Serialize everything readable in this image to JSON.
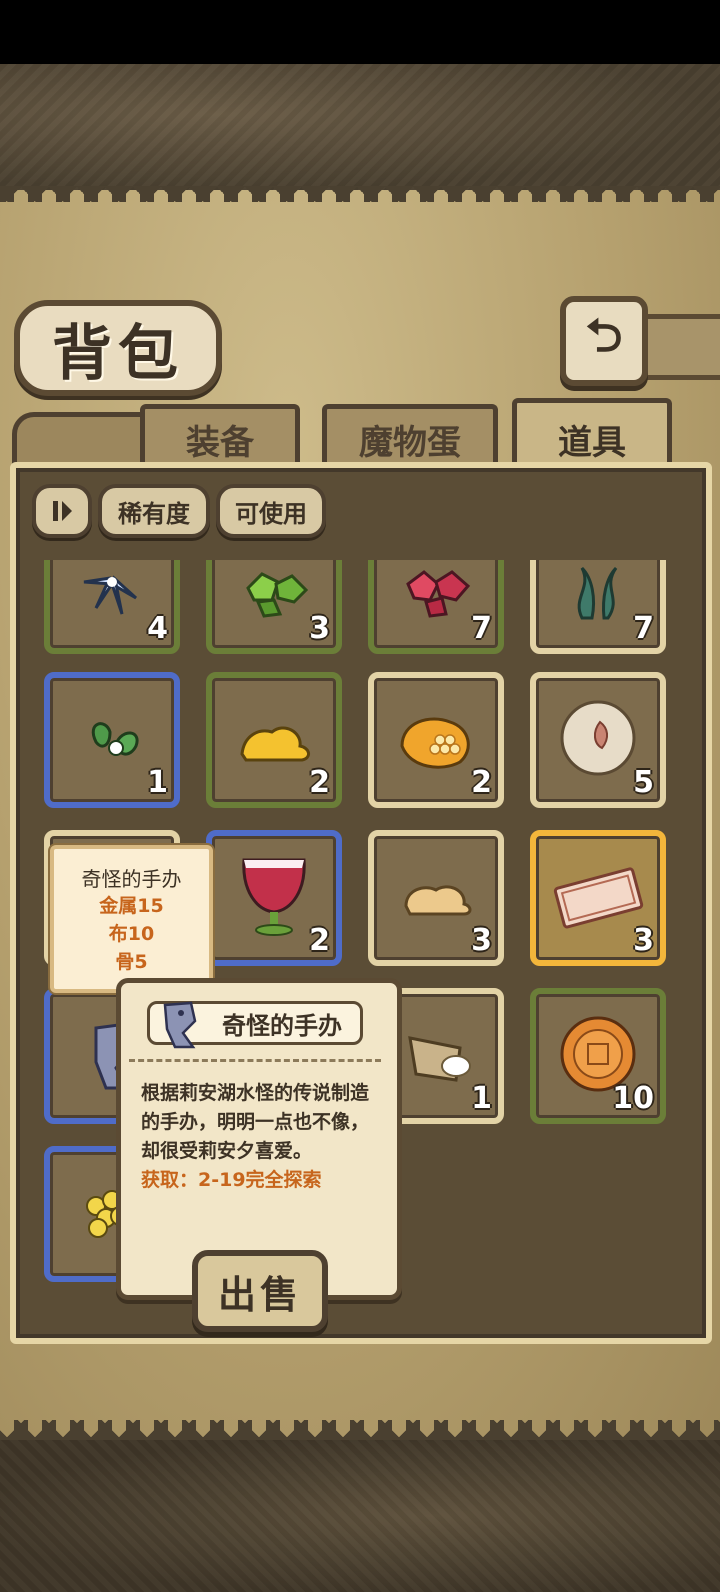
{
  "header": {
    "title": "背包"
  },
  "tabs": [
    {
      "label": "装备",
      "active": false
    },
    {
      "label": "魔物蛋",
      "active": false
    },
    {
      "label": "道具",
      "active": true
    }
  ],
  "filters": {
    "sort_icon": "sort-icon",
    "rarity_label": "稀有度",
    "usable_label": "可使用"
  },
  "items": [
    {
      "name": "blue-flower-icon",
      "qty": "4",
      "frame": "green"
    },
    {
      "name": "green-crystal-icon",
      "qty": "3",
      "frame": "green"
    },
    {
      "name": "red-crystal-icon",
      "qty": "7",
      "frame": "green"
    },
    {
      "name": "seaweed-icon",
      "qty": "7",
      "frame": "cream"
    },
    {
      "name": "tea-leaf-icon",
      "qty": "1",
      "frame": "blue"
    },
    {
      "name": "gold-blob-icon",
      "qty": "2",
      "frame": "green"
    },
    {
      "name": "honeycomb-icon",
      "qty": "2",
      "frame": "cream"
    },
    {
      "name": "pearl-icon",
      "qty": "5",
      "frame": "cream"
    },
    {
      "name": "figure-icon",
      "qty": "",
      "frame": "cream"
    },
    {
      "name": "wine-glass-icon",
      "qty": "2",
      "frame": "blue"
    },
    {
      "name": "dough-icon",
      "qty": "3",
      "frame": "cream"
    },
    {
      "name": "ticket-icon",
      "qty": "3",
      "frame": "gold"
    },
    {
      "name": "lake-monster-figure-icon",
      "qty": "",
      "frame": "blue"
    },
    {
      "name": "sack-icon",
      "qty": "",
      "frame": "blue"
    },
    {
      "name": "rice-bag-icon",
      "qty": "1",
      "frame": "cream"
    },
    {
      "name": "mooncake-icon",
      "qty": "10",
      "frame": "green"
    },
    {
      "name": "yellow-flower-icon",
      "qty": "",
      "frame": "blue"
    }
  ],
  "hover_tooltip": {
    "title": "奇怪的手办",
    "materials": [
      "金属15",
      "布10",
      "骨5"
    ]
  },
  "detail": {
    "name": "奇怪的手办",
    "description": "根据莉安湖水怪的传说制造的手办，明明一点也不像，却很受莉安夕喜爱。",
    "source": "获取：2-19完全探索",
    "sell_label": "出售"
  }
}
